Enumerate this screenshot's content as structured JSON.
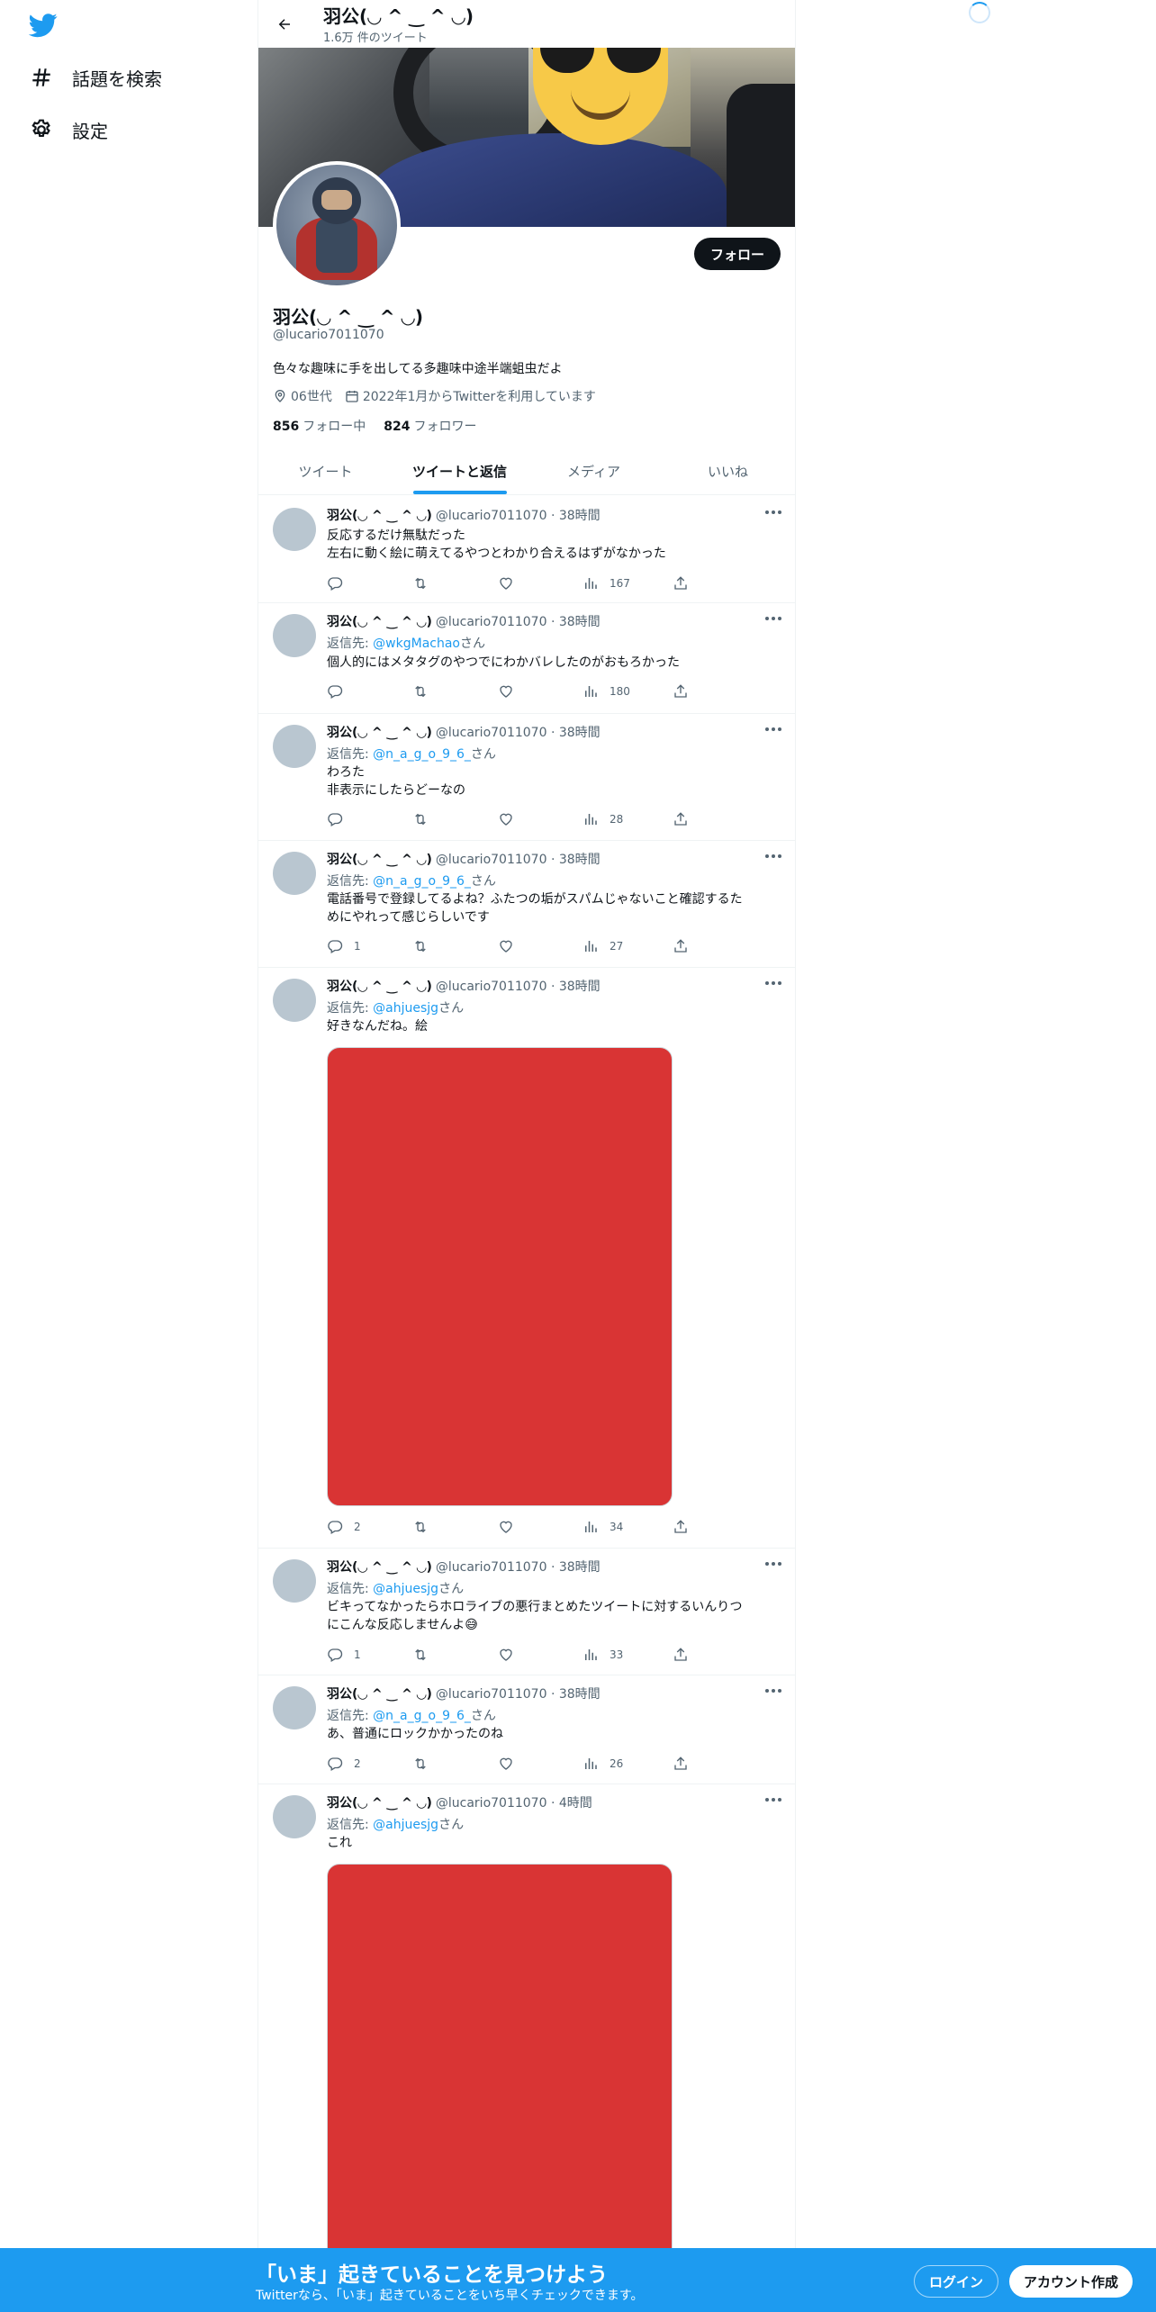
{
  "nav": {
    "items": [
      {
        "label": "話題を検索",
        "icon": "hashtag-icon"
      },
      {
        "label": "設定",
        "icon": "gear-icon"
      }
    ]
  },
  "header": {
    "title": "羽公(◡ ^ ‿ ^ ◡)",
    "subtitle": "1.6万 件のツイート"
  },
  "profile": {
    "follow_label": "フォロー",
    "name": "羽公(◡ ^ ‿ ^ ◡)",
    "handle": "@lucario7011070",
    "bio": "色々な趣味に手を出してる多趣味中途半端蛆虫だよ",
    "location": "06世代",
    "joined": "2022年1月からTwitterを利用しています",
    "following_count": "856",
    "following_label": "フォロー中",
    "followers_count": "824",
    "followers_label": "フォロワー"
  },
  "tabs": [
    {
      "label": "ツイート",
      "active": false
    },
    {
      "label": "ツイートと返信",
      "active": true
    },
    {
      "label": "メディア",
      "active": false
    },
    {
      "label": "いいね",
      "active": false
    }
  ],
  "tweets": [
    {
      "name": "羽公(◡ ^ ‿ ^ ◡)",
      "handle": "@lucario7011070",
      "time": "38時間",
      "reply_prefix": "",
      "reply_to": "",
      "reply_suffix": "",
      "lines": [
        "反応するだけ無駄だった",
        "左右に動く絵に萌えてるやつとわかり合えるはずがなかった"
      ],
      "replies": "",
      "retweets": "",
      "likes": "",
      "views": "167"
    },
    {
      "name": "羽公(◡ ^ ‿ ^ ◡)",
      "handle": "@lucario7011070",
      "time": "38時間",
      "reply_prefix": "返信先: ",
      "reply_to": "@wkgMachao",
      "reply_suffix": "さん",
      "lines": [
        "個人的にはメタタグのやつでにわかバレしたのがおもろかった"
      ],
      "replies": "",
      "retweets": "",
      "likes": "",
      "views": "180"
    },
    {
      "name": "羽公(◡ ^ ‿ ^ ◡)",
      "handle": "@lucario7011070",
      "time": "38時間",
      "reply_prefix": "返信先: ",
      "reply_to": "@n_a_g_o_9_6_",
      "reply_suffix": "さん",
      "lines": [
        "わろた",
        "非表示にしたらどーなの"
      ],
      "replies": "",
      "retweets": "",
      "likes": "",
      "views": "28"
    },
    {
      "name": "羽公(◡ ^ ‿ ^ ◡)",
      "handle": "@lucario7011070",
      "time": "38時間",
      "reply_prefix": "返信先: ",
      "reply_to": "@n_a_g_o_9_6_",
      "reply_suffix": "さん",
      "lines": [
        "電話番号で登録してるよね？ふたつの垢がスパムじゃないこと確認するた",
        "めにやれって感じらしいです"
      ],
      "replies": "1",
      "retweets": "",
      "likes": "",
      "views": "27"
    },
    {
      "name": "羽公(◡ ^ ‿ ^ ◡)",
      "handle": "@lucario7011070",
      "time": "38時間",
      "reply_prefix": "返信先: ",
      "reply_to": "@ahjuesjg",
      "reply_suffix": "さん",
      "lines": [
        "好きなんだね。絵"
      ],
      "replies": "2",
      "retweets": "",
      "likes": "",
      "views": "34"
    },
    {
      "name": "羽公(◡ ^ ‿ ^ ◡)",
      "handle": "@lucario7011070",
      "time": "38時間",
      "reply_prefix": "返信先: ",
      "reply_to": "@ahjuesjg",
      "reply_suffix": "さん",
      "lines": [
        "ビキってなかったらホロライブの悪行まとめたツイートに対するいんりつ",
        "にこんな反応しませんよ😅"
      ],
      "replies": "1",
      "retweets": "",
      "likes": "",
      "views": "33"
    },
    {
      "name": "羽公(◡ ^ ‿ ^ ◡)",
      "handle": "@lucario7011070",
      "time": "38時間",
      "reply_prefix": "返信先: ",
      "reply_to": "@n_a_g_o_9_6_",
      "reply_suffix": "さん",
      "lines": [
        "あ、普通にロックかかったのね"
      ],
      "replies": "2",
      "retweets": "",
      "likes": "",
      "views": "26"
    },
    {
      "name": "羽公(◡ ^ ‿ ^ ◡)",
      "handle": "@lucario7011070",
      "time": "4時間",
      "reply_prefix": "返信先: ",
      "reply_to": "@ahjuesjg",
      "reply_suffix": "さん",
      "lines": [
        "これ"
      ],
      "replies": "",
      "retweets": "",
      "likes": "",
      "views": ""
    }
  ],
  "bottom_bar": {
    "title": "「いま」起きていることを見つけよう",
    "subtitle": "Twitterなら、「いま」起きていることをいち早くチェックできます。",
    "login_label": "ログイン",
    "signup_label": "アカウント作成"
  },
  "colors": {
    "accent": "#1d9bf0",
    "text": "#0f1419",
    "muted": "#536471",
    "media_placeholder": "#d93434"
  }
}
